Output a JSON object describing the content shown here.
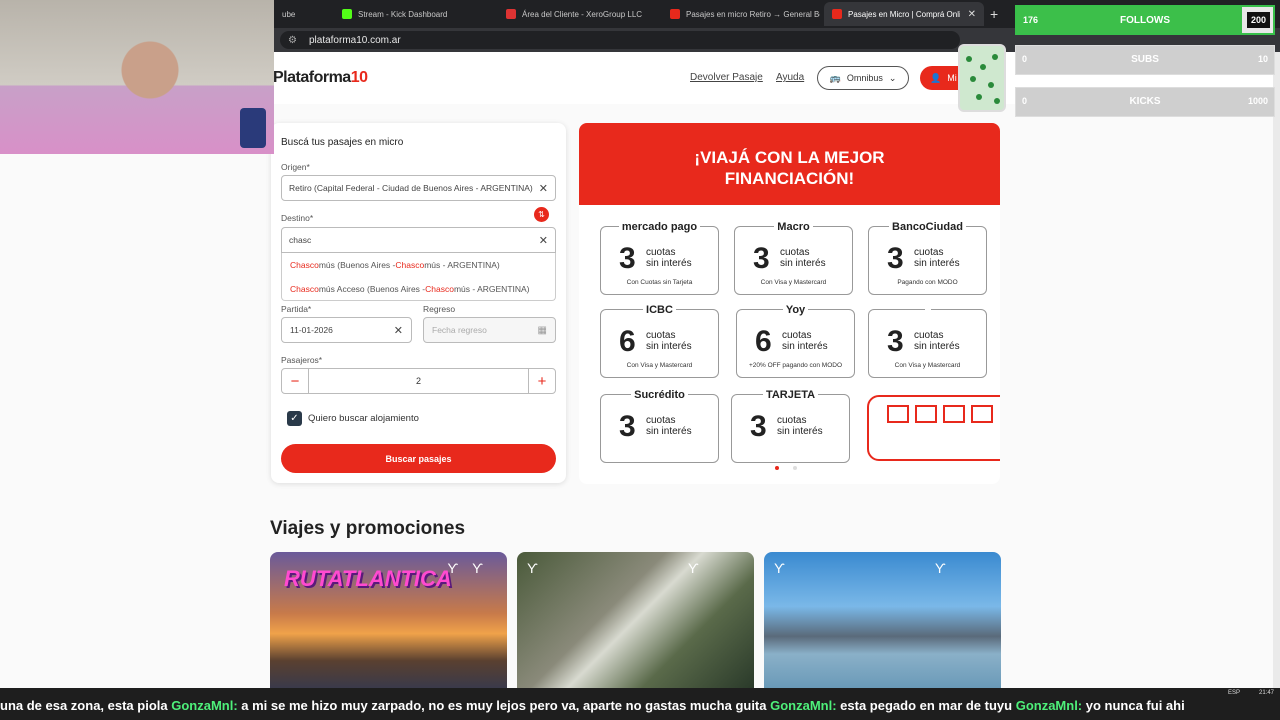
{
  "browser": {
    "tabs": [
      {
        "label": "ube",
        "active": false
      },
      {
        "label": "Stream - Kick Dashboard",
        "active": false
      },
      {
        "label": "Área del Cliente - XeroGroup LLC",
        "active": false
      },
      {
        "label": "Pasajes en micro Retiro → General Be",
        "active": false
      },
      {
        "label": "Pasajes en Micro | Comprá Onlin",
        "active": true
      }
    ],
    "url": "plataforma10.com.ar"
  },
  "header": {
    "logo": "Plataforma",
    "logo_suffix": "10",
    "return_link": "Devolver Pasaje",
    "help_link": "Ayuda",
    "transport_selector": "Omnibus",
    "account_button": "Mi"
  },
  "search": {
    "title": "Buscá tus pasajes en micro",
    "origin_label": "Origen*",
    "origin_value": "Retiro (Capital Federal - Ciudad de Buenos Aires - ARGENTINA)",
    "destination_label": "Destino*",
    "destination_value": "chasc",
    "suggestions": [
      {
        "match": "Chasco",
        "rest": "mús (Buenos Aires - ",
        "match2": "Chasco",
        "rest2": "mús - ARGENTINA)"
      },
      {
        "match": "Chasco",
        "rest": "mús Acceso (Buenos Aires - ",
        "match2": "Chasco",
        "rest2": "mús - ARGENTINA)"
      }
    ],
    "departure_label": "Partida*",
    "departure_value": "11-01-2026",
    "return_label": "Regreso",
    "return_placeholder": "Fecha regreso",
    "passengers_label": "Pasajeros*",
    "passengers_value": "2",
    "lodging_label": "Quiero buscar alojamiento",
    "lodging_checked": true,
    "submit_label": "Buscar pasajes"
  },
  "banner": {
    "headline_1": "¡VIAJÁ CON LA MEJOR",
    "headline_2": "FINANCIACIÓN!",
    "cards": [
      {
        "bank": "mercado pago",
        "count": "3",
        "line1": "cuotas",
        "line2": "sin interés",
        "condition": "Con Cuotas sin Tarjeta"
      },
      {
        "bank": "Macro",
        "count": "3",
        "line1": "cuotas",
        "line2": "sin interés",
        "condition": "Con Visa y Mastercard"
      },
      {
        "bank": "BancoCiudad",
        "count": "3",
        "line1": "cuotas",
        "line2": "sin interés",
        "condition": "Pagando con MODO"
      },
      {
        "bank": "ICBC",
        "count": "6",
        "line1": "cuotas",
        "line2": "sin interés",
        "condition": "Con Visa y Mastercard"
      },
      {
        "bank": "Yoy",
        "count": "6",
        "line1": "cuotas",
        "line2": "sin interés",
        "condition": "+20% OFF pagando con MODO"
      },
      {
        "bank": "",
        "count": "3",
        "line1": "cuotas",
        "line2": "sin interés",
        "condition": "Con Visa y Mastercard"
      },
      {
        "bank": "Sucrédito",
        "count": "3",
        "line1": "cuotas",
        "line2": "sin interés",
        "condition": ""
      },
      {
        "bank": "TARJETA",
        "count": "3",
        "line1": "cuotas",
        "line2": "sin interés",
        "condition": ""
      }
    ]
  },
  "promos": {
    "title": "Viajes y promociones",
    "first_label": "RUTATLANTICA"
  },
  "overlay": {
    "follows_label": "FOLLOWS",
    "follows_current": "176",
    "follows_goal": "200",
    "follows_progress": 0.88,
    "subs_label": "SUBS",
    "subs_current": "0",
    "subs_goal": "10",
    "kicks_label": "KICKS",
    "kicks_current": "0",
    "kicks_goal": "1000",
    "chat": [
      {
        "user": "",
        "msg": "una de esa zona, esta piola "
      },
      {
        "user": "GonzaMnl:",
        "msg": " a mi se me hizo muy zarpado, no es muy lejos pero va, aparte no gastas mucha guita "
      },
      {
        "user": "GonzaMnl:",
        "msg": " esta pegado en mar de tuyu "
      },
      {
        "user": "GonzaMnl:",
        "msg": " yo nunca fui ahi"
      }
    ],
    "lang": "ESP",
    "clock": "21:47"
  },
  "colors": {
    "brand": "#e8291c",
    "follows_bar": "#3cbf4a",
    "chat_user": "#4ef07a"
  }
}
